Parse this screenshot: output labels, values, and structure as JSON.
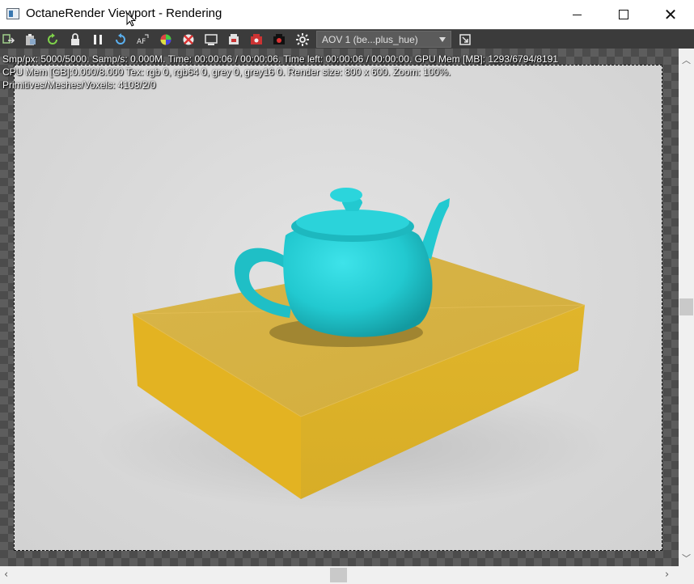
{
  "window": {
    "title": "OctaneRender Viewport - Rendering"
  },
  "toolbar": {
    "icons": [
      "import-icon",
      "clipboard-icon",
      "refresh-icon",
      "lock-icon",
      "pause-icon",
      "restart-icon",
      "autofocus-icon",
      "color-picker-icon",
      "region-icon",
      "viewport-icon",
      "camera-icon",
      "film-icon",
      "save-icon",
      "settings-icon"
    ],
    "aov_selector": {
      "selected": "AOV 1 (be...plus_hue)"
    },
    "snapshot_label": "snapshot"
  },
  "stats": {
    "line1": "Smp/px: 5000/5000.  Samp/s: 0.000M.  Time: 00:00:06 / 00:00:06.  Time left: 00:00:06 / 00:00:00.  GPU Mem [MB]: 1293/6794/8191",
    "line2": "CPU Mem [GB]:0.000/8.000  Tex: rgb 0, rgb64 0, grey 0, grey16 0.  Render size: 800 x 600.  Zoom: 100%.",
    "line3": "Primitives/Meshes/Voxels: 4108/2/0"
  },
  "colors": {
    "teapot": "#22c9d0",
    "box": "#d9b43a",
    "background": "#dcdcdc",
    "toolbar": "#3b3b3b"
  }
}
